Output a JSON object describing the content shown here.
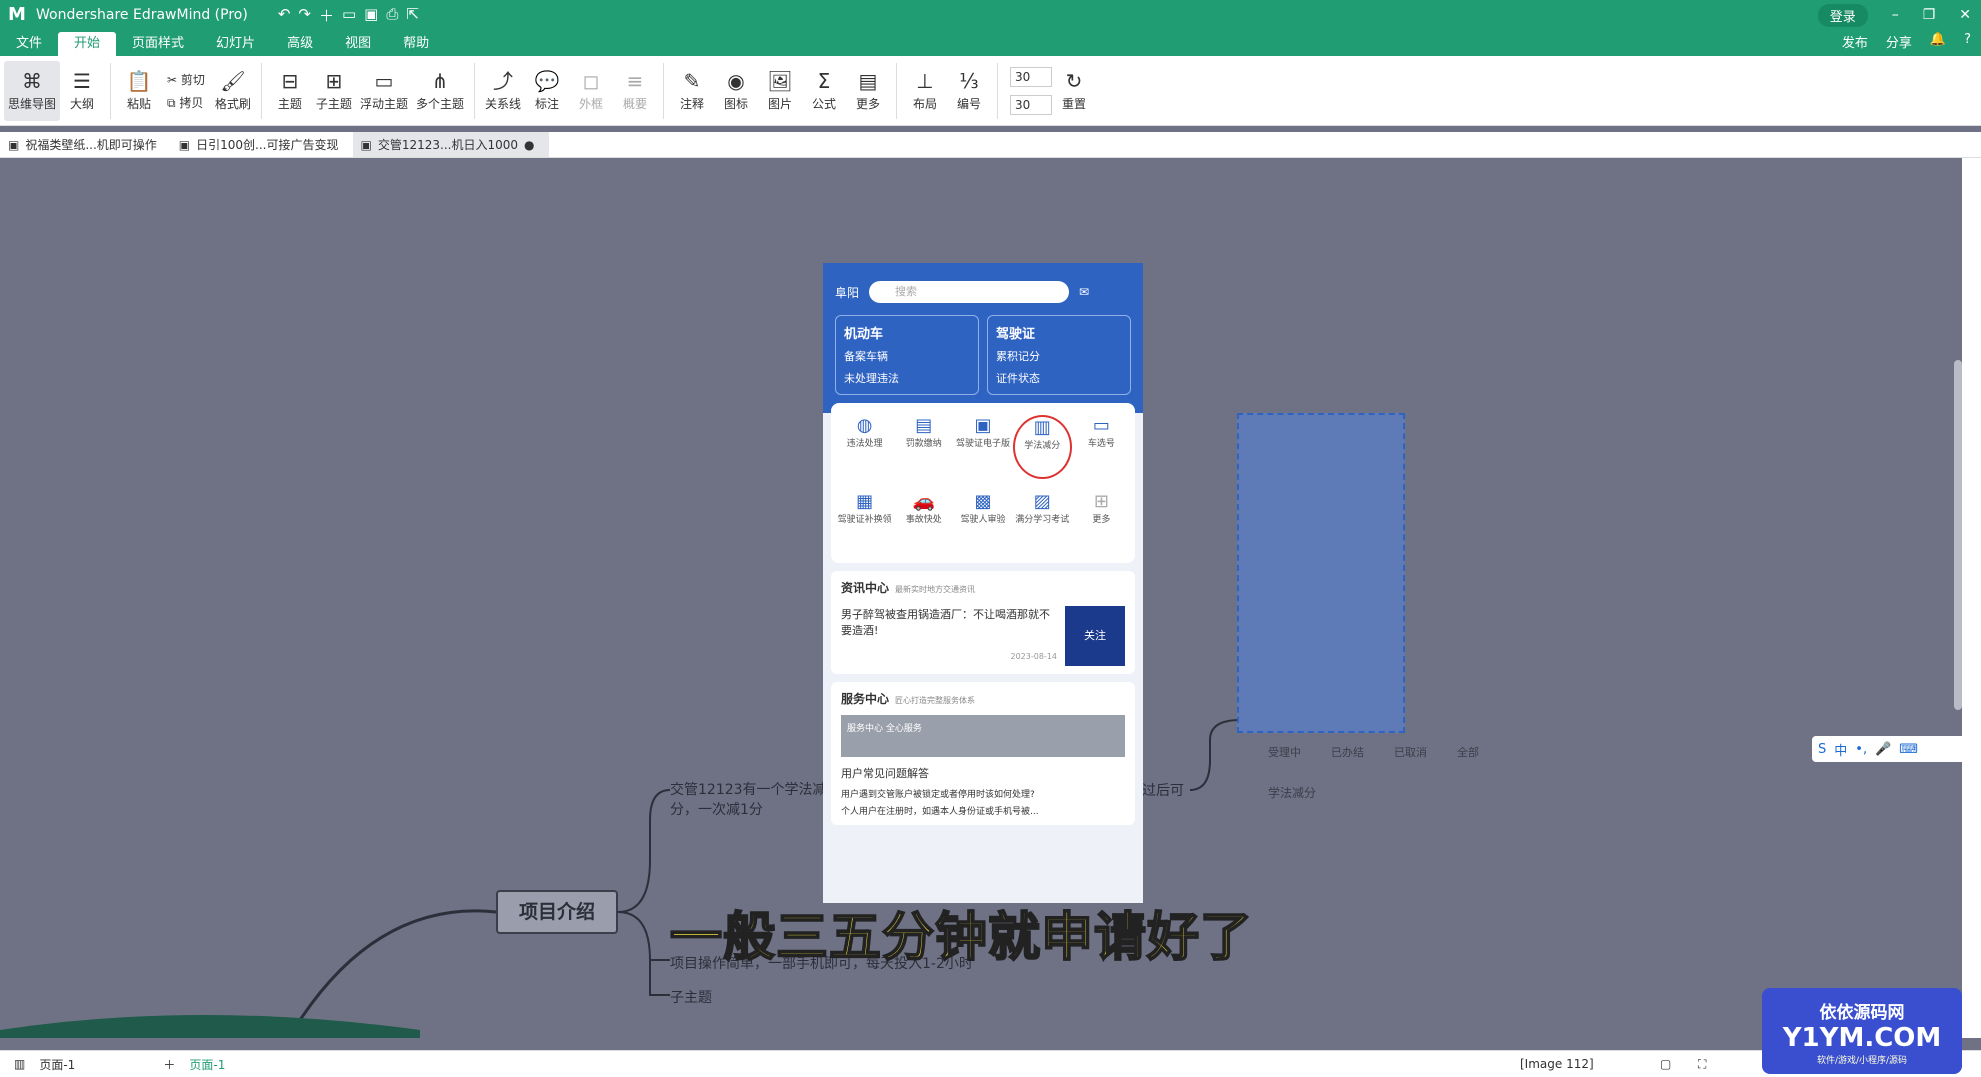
{
  "titlebar": {
    "app_title": "Wondershare EdrawMind (Pro)",
    "login": "登录"
  },
  "menubar": {
    "items": [
      "文件",
      "开始",
      "页面样式",
      "幻灯片",
      "高级",
      "视图",
      "帮助"
    ],
    "active": "开始",
    "publish": "发布",
    "share": "分享"
  },
  "ribbon": {
    "mindmap": "思维导图",
    "outline": "大纲",
    "paste": "粘贴",
    "cut": "剪切",
    "copy": "拷贝",
    "format_brush": "格式刷",
    "topic": "主题",
    "subtopic": "子主题",
    "floating": "浮动主题",
    "multi": "多个主题",
    "relation": "关系线",
    "callout": "标注",
    "boundary": "外框",
    "summary": "概要",
    "note": "注释",
    "icon": "图标",
    "image": "图片",
    "formula": "公式",
    "more": "更多",
    "layout": "布局",
    "numbering": "编号",
    "spacing_h": "30",
    "spacing_v": "30",
    "reset": "重置"
  },
  "tabs": [
    "祝福类壁纸...机即可操作",
    "日引100创...可接广告变现",
    "交管12123...机日入1000"
  ],
  "phone": {
    "city": "阜阳",
    "search_placeholder": "搜索",
    "card1": {
      "title": "机动车",
      "l1": "备案车辆",
      "l2": "未处理违法"
    },
    "card2": {
      "title": "驾驶证",
      "l1": "累积记分",
      "l2": "证件状态"
    },
    "grid": [
      "违法处理",
      "罚款缴纳",
      "驾驶证电子版",
      "学法减分",
      "车选号",
      "驾驶证补换领",
      "事故快处",
      "驾驶人审验",
      "满分学习考试",
      "更多"
    ],
    "news": {
      "title": "资讯中心",
      "sub": "最新实时地方交通资讯",
      "headline": "男子醉驾被查用锅造酒厂：不让喝酒那就不要造酒!",
      "date": "2023-08-14",
      "img_text": "关注"
    },
    "service": {
      "title": "服务中心",
      "sub": "匠心打造完整服务体系",
      "banner": "服务中心",
      "banner2": "全心服务",
      "faq_title": "用户常见问题解答",
      "q1": "用户遇到交管账户被锁定或者停用时该如何处理?",
      "q2": "个人用户在注册时，如遇本人身份证或手机号被..."
    }
  },
  "mindmap": {
    "topic": "项目介绍",
    "t1": "交管12123有一个学法减分，一次减1分",
    "t2": "项目操作简单，一部手机即可，每天投入1-2小时",
    "t3": "子主题",
    "t4": "过后可",
    "thumb_tabs": [
      "受理中",
      "已办结",
      "已取消",
      "全部"
    ],
    "thumb_item": "学法减分"
  },
  "subtitle": "一般三五分钟就申请好了",
  "statusbar": {
    "page_select": "页面-1",
    "page_tab": "页面-1",
    "image_info": "[Image 112]"
  },
  "ime": {
    "lang": "中"
  },
  "watermark": {
    "l1": "依依源码网",
    "l2": "Y1YM.COM",
    "l3": "软件/游戏/小程序/源码"
  }
}
